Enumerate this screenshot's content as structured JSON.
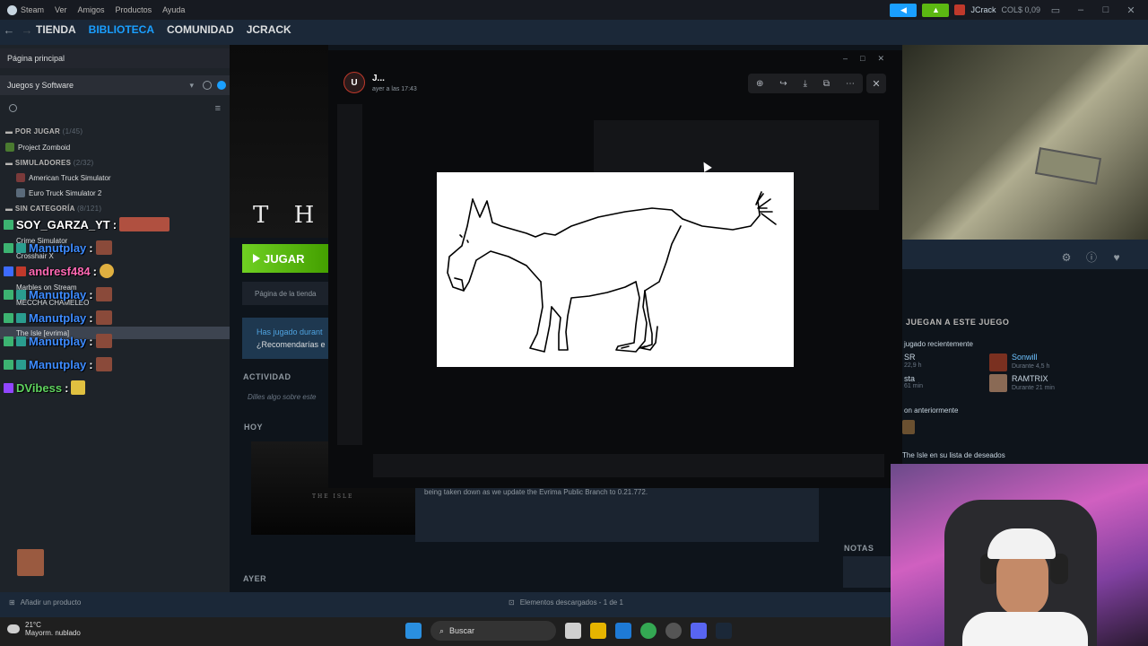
{
  "menubar": {
    "items": [
      "Steam",
      "Ver",
      "Amigos",
      "Productos",
      "Ayuda"
    ],
    "user": "JCrack",
    "balance": "COL$ 0,09"
  },
  "nav": {
    "tabs": [
      "TIENDA",
      "BIBLIOTECA",
      "COMUNIDAD",
      "JCRACK"
    ],
    "active_tab": "BIBLIOTECA"
  },
  "sidebar": {
    "home": "Página principal",
    "filter": "Juegos y Software",
    "sections": [
      {
        "title": "POR JUGAR",
        "count": "(1/45)"
      },
      {
        "title": "SIMULADORES",
        "count": "(2/32)"
      },
      {
        "title": "SIN CATEGORÍA",
        "count": "(8/121)"
      }
    ],
    "items": [
      "Project Zomboid",
      "American Truck Simulator",
      "Euro Truck Simulator 2",
      "Crime Simulator",
      "Crosshair X",
      "Marbles on Stream",
      "MECCHA CHAMELEO",
      "The Isle [evrima]"
    ],
    "add_product": "Añadir un producto"
  },
  "chat": [
    {
      "user": "SOY_GARZA_YT",
      "color": "#ffffff"
    },
    {
      "user": "Manutplay",
      "color": "#3d8bff"
    },
    {
      "user": "andresf484",
      "color": "#ff69b4"
    },
    {
      "user": "Manutplay",
      "color": "#3d8bff"
    },
    {
      "user": "Manutplay",
      "color": "#3d8bff"
    },
    {
      "user": "Manutplay",
      "color": "#3d8bff"
    },
    {
      "user": "Manutplay",
      "color": "#3d8bff"
    },
    {
      "user": "DVibess",
      "color": "#5fd35f"
    }
  ],
  "game": {
    "title_art": "T H",
    "play_label": "JUGAR",
    "store_page": "Página de la tienda",
    "played_line1": "Has jugado durant",
    "played_line2": "¿Recomendarías e",
    "activity_header": "ACTIVIDAD",
    "say_placeholder": "Dilles algo sobre este",
    "today_header": "HOY",
    "news_art": "THE ISLE",
    "news_text": "being taken down as we update the Evrima Public Branch to 0.21.772.",
    "yesterday_header": "AYER",
    "notes_header": "NOTAS"
  },
  "friends_panel": {
    "title": "JUEGAN A ESTE JUEGO",
    "recent": "jugado recientemente",
    "f1_partial": "SR",
    "f1_time": "22,9 h",
    "f2_partial": "sta",
    "f2_time": "61 min",
    "f3_name": "Sonwill",
    "f3_time": "Durante 4,5 h",
    "f4_name": "RAMTRIX",
    "f4_time": "Durante 21 min",
    "previous": "on anteriormente",
    "wishlist": "The Isle en su lista de deseados"
  },
  "viewer": {
    "sender": "J...",
    "time": "ayer a las 17:43"
  },
  "status": {
    "downloads": "Elementos descargados - 1 de 1"
  },
  "taskbar": {
    "temp": "21°C",
    "weather": "Mayorm. nublado",
    "search": "Buscar"
  },
  "colors": {
    "accent": "#1a9fff",
    "play": "#5cb812"
  }
}
